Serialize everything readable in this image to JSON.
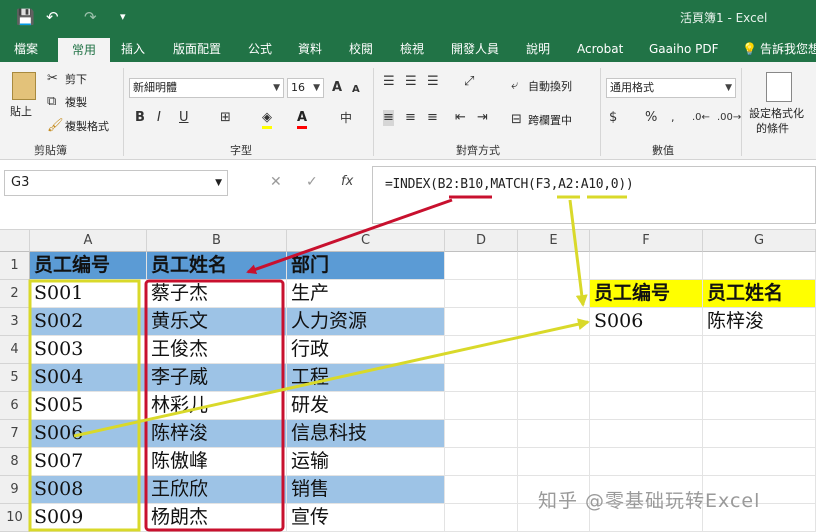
{
  "window": {
    "title": "活頁簿1 - Excel"
  },
  "quick_access": {
    "save_icon": "💾",
    "undo_icon": "↶",
    "redo_icon": "↷",
    "customize_icon": "▾"
  },
  "tabs": [
    "檔案",
    "常用",
    "插入",
    "版面配置",
    "公式",
    "資料",
    "校閱",
    "檢視",
    "開發人員",
    "說明",
    "Acrobat",
    "Gaaiho PDF",
    "告訴我您想"
  ],
  "active_tab": "常用",
  "ribbon": {
    "clipboard": {
      "paste": "貼上",
      "cut": "剪下",
      "copy": "複製",
      "format_painter": "複製格式",
      "label": "剪貼簿"
    },
    "font": {
      "name": "新細明體",
      "size": "16",
      "bold": "B",
      "italic": "I",
      "underline": "U",
      "grow": "A",
      "shrink": "A",
      "label": "字型"
    },
    "alignment": {
      "wrap": "自動換列",
      "merge": "跨欄置中",
      "label": "對齊方式"
    },
    "number": {
      "format": "通用格式",
      "label": "數值"
    },
    "styles": {
      "conditional": "設定格式化",
      "conditional2": "的條件"
    }
  },
  "formula_bar": {
    "name_box": "G3",
    "cancel": "✕",
    "enter": "✓",
    "fx": "fx",
    "formula": "=INDEX(B2:B10,MATCH(F3,A2:A10,0))"
  },
  "columns": [
    "A",
    "B",
    "C",
    "D",
    "E",
    "F",
    "G"
  ],
  "rows": [
    "1",
    "2",
    "3",
    "4",
    "5",
    "6",
    "7",
    "8",
    "9",
    "10"
  ],
  "table": {
    "headers": [
      "员工编号",
      "员工姓名",
      "部门"
    ],
    "data": [
      [
        "S001",
        "蔡子杰",
        "生产"
      ],
      [
        "S002",
        "黄乐文",
        "人力资源"
      ],
      [
        "S003",
        "王俊杰",
        "行政"
      ],
      [
        "S004",
        "李子威",
        "工程"
      ],
      [
        "S005",
        "林彩儿",
        "研发"
      ],
      [
        "S006",
        "陈梓浚",
        "信息科技"
      ],
      [
        "S007",
        "陈傲峰",
        "运输"
      ],
      [
        "S008",
        "王欣欣",
        "销售"
      ],
      [
        "S009",
        "杨朗杰",
        "宣传"
      ]
    ]
  },
  "lookup": {
    "headers": [
      "员工编号",
      "员工姓名"
    ],
    "values": [
      "S006",
      "陈梓浚"
    ]
  },
  "watermark": "知乎 @零基础玩转Excel",
  "colors": {
    "excel_green": "#217346",
    "band_blue": "#9dc3e6",
    "header_blue": "#5b9bd5",
    "highlight_yellow": "#ffff00",
    "annot_red": "#c8102e",
    "annot_yellow": "#d9d92a"
  }
}
